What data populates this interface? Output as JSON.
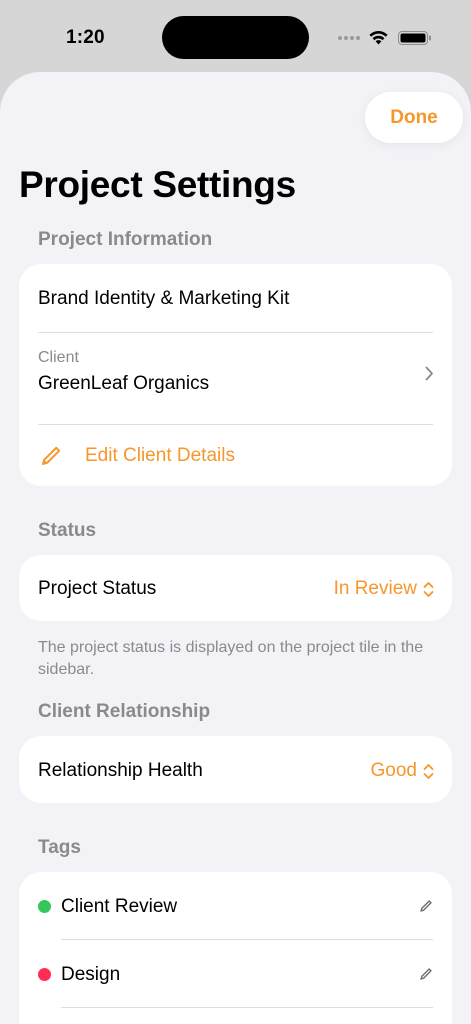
{
  "status_bar": {
    "time": "1:20"
  },
  "sheet": {
    "done_label": "Done",
    "title": "Project Settings",
    "project_information": {
      "header": "Project Information",
      "project_name": "Brand Identity & Marketing Kit",
      "client_label": "Client",
      "client_name": "GreenLeaf Organics",
      "edit_client_label": "Edit Client Details"
    },
    "status": {
      "header": "Status",
      "row_label": "Project Status",
      "value": "In Review",
      "footnote": "The project status is displayed on the project tile in the sidebar."
    },
    "client_relationship": {
      "header": "Client Relationship",
      "row_label": "Relationship Health",
      "value": "Good"
    },
    "tags": {
      "header": "Tags",
      "items": [
        {
          "label": "Client Review",
          "color": "#34c759"
        },
        {
          "label": "Design",
          "color": "#ff2d55"
        }
      ]
    }
  },
  "colors": {
    "accent": "#f7962b",
    "background": "#f2f2f7"
  }
}
